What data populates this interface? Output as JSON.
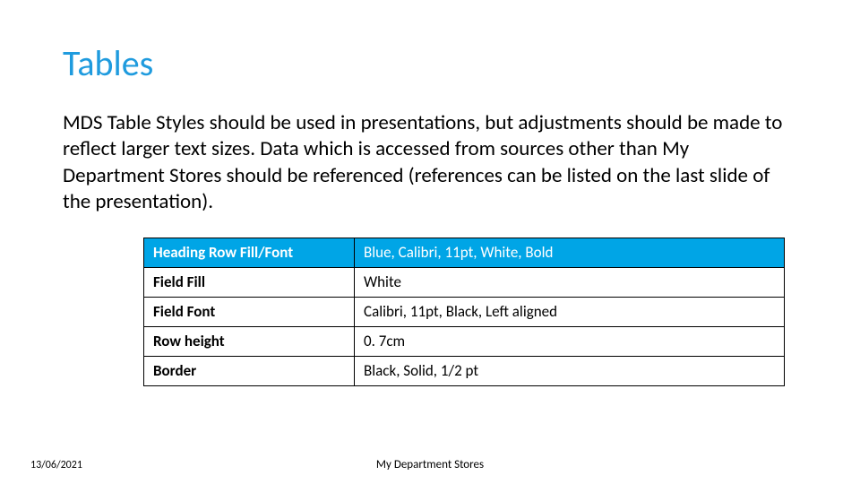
{
  "title": "Tables",
  "body": "MDS Table Styles should be used in presentations, but adjustments should be made to reflect larger text sizes. Data which is accessed from sources other than My Department Stores should be referenced (references can be listed on the last slide of the presentation).",
  "table": {
    "header": {
      "label": "Heading Row Fill/Font",
      "value": "Blue, Calibri, 11pt, White,  Bold"
    },
    "rows": [
      {
        "label": "Field Fill",
        "value": "White"
      },
      {
        "label": "Field Font",
        "value": "Calibri, 11pt, Black, Left aligned"
      },
      {
        "label": "Row height",
        "value": "0. 7cm"
      },
      {
        "label": "Border",
        "value": "Black, Solid, 1/2 pt"
      }
    ]
  },
  "footer": {
    "date": "13/06/2021",
    "org": "My Department Stores"
  }
}
